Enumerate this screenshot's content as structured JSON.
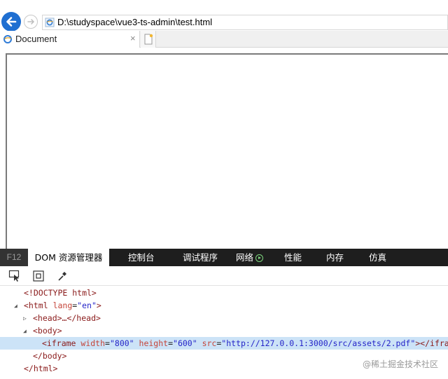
{
  "address_bar": {
    "url": "D:\\studyspace\\vue3-ts-admin\\test.html"
  },
  "tab": {
    "title": "Document",
    "close": "×"
  },
  "devtools": {
    "f12_label": "F12",
    "tabs": [
      "DOM 资源管理器",
      "控制台",
      "调试程序",
      "网络",
      "性能",
      "内存",
      "仿真"
    ],
    "active_tab": "DOM 资源管理器"
  },
  "dom_tree": {
    "doctype": "<!DOCTYPE html>",
    "html_open": {
      "tag": "<html",
      "attr": "lang",
      "eq": "=",
      "value": "\"en\"",
      "close": ">"
    },
    "head": "<head>…</head>",
    "body_open": "<body>",
    "iframe": {
      "open": "<iframe",
      "width_attr": "width",
      "width_val": "\"800\"",
      "height_attr": "height",
      "height_val": "\"600\"",
      "src_attr": "src",
      "src_val": "\"http://127.0.0.1:3000/src/assets/2.pdf\"",
      "close": "></iframe>",
      "eq": "="
    },
    "body_close": "</body>",
    "html_close": "</html>"
  },
  "watermark": "@稀土掘金技术社区",
  "colors": {
    "accent": "#1f6fd1",
    "devbar": "#1e1e1e",
    "selection": "#cce3f7"
  }
}
